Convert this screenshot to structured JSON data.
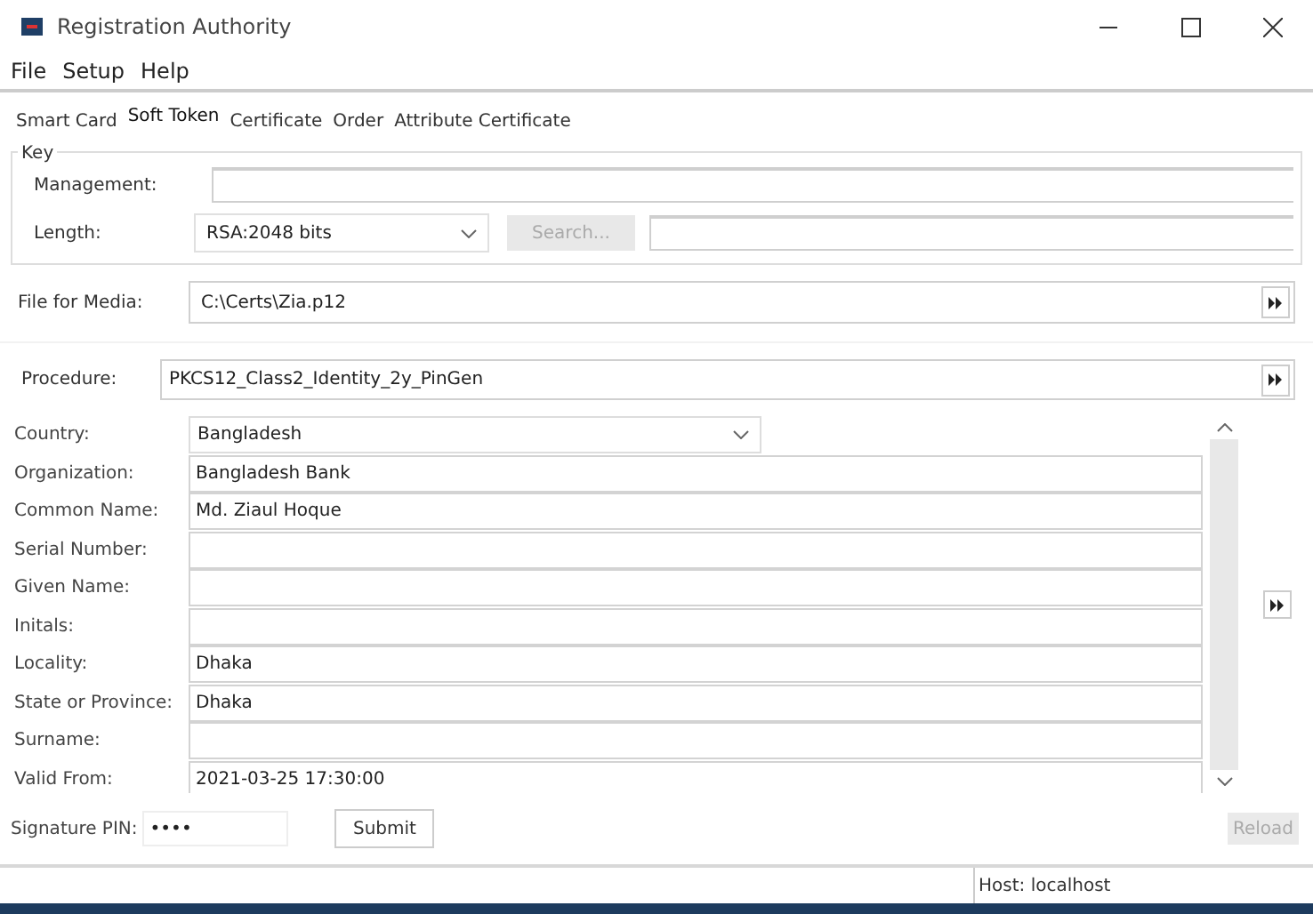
{
  "window": {
    "title": "Registration Authority"
  },
  "menu": [
    "File",
    "Setup",
    "Help"
  ],
  "tabs": [
    {
      "label": "Smart Card",
      "selected": false
    },
    {
      "label": "Soft Token",
      "selected": true
    },
    {
      "label": "Certificate",
      "selected": false
    },
    {
      "label": "Order",
      "selected": false
    },
    {
      "label": "Attribute Certificate",
      "selected": false
    }
  ],
  "key": {
    "legend": "Key",
    "management_label": "Management:",
    "length_label": "Length:",
    "length_value": "RSA:2048 bits",
    "search_button": {
      "label": "Search...",
      "disabled": true
    }
  },
  "file_for_media": {
    "label": "File for Media:",
    "value": "C:\\Certs\\Zia.p12"
  },
  "procedure": {
    "label": "Procedure:",
    "value": "PKCS12_Class2_Identity_2y_PinGen"
  },
  "fields": [
    {
      "label": "Country:",
      "value": "Bangladesh",
      "kind": "combo"
    },
    {
      "label": "Organization:",
      "value": "Bangladesh Bank",
      "kind": "text"
    },
    {
      "label": "Common Name:",
      "value": "Md. Ziaul Hoque",
      "kind": "text"
    },
    {
      "label": "Serial Number:",
      "kind": "text"
    },
    {
      "label": "Given Name:",
      "kind": "text"
    },
    {
      "label": "Initals:",
      "kind": "text"
    },
    {
      "label": "Locality:",
      "value": "Dhaka",
      "kind": "text"
    },
    {
      "label": "State or Province:",
      "value": "Dhaka",
      "kind": "text"
    },
    {
      "label": "Surname:",
      "kind": "text"
    },
    {
      "label": "Valid From:",
      "value": "2021-03-25 17:30:00",
      "kind": "text"
    }
  ],
  "signature_pin": {
    "label": "Signature PIN:",
    "value": "••••"
  },
  "submit_button": {
    "label": "Submit"
  },
  "reload_button": {
    "label": "Reload",
    "disabled": true
  },
  "status_bar": {
    "host": "Host: localhost"
  }
}
